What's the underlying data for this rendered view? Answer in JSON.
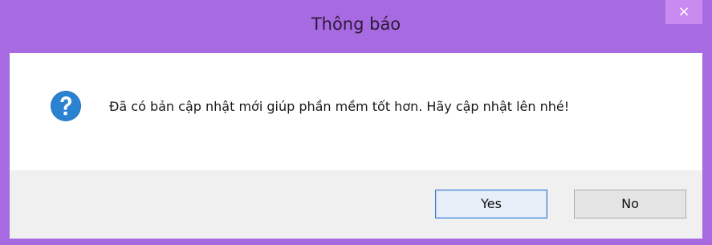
{
  "window": {
    "title": "Thông báo",
    "close_glyph": "×"
  },
  "message": {
    "icon": "question-icon",
    "text": "Đã có bản cập nhật mới giúp phần mềm tốt hơn. Hãy cập nhật lên nhé!"
  },
  "buttons": {
    "yes_label": "Yes",
    "no_label": "No"
  },
  "colors": {
    "frame": "#a86ae0",
    "icon": "#1e74c4"
  }
}
